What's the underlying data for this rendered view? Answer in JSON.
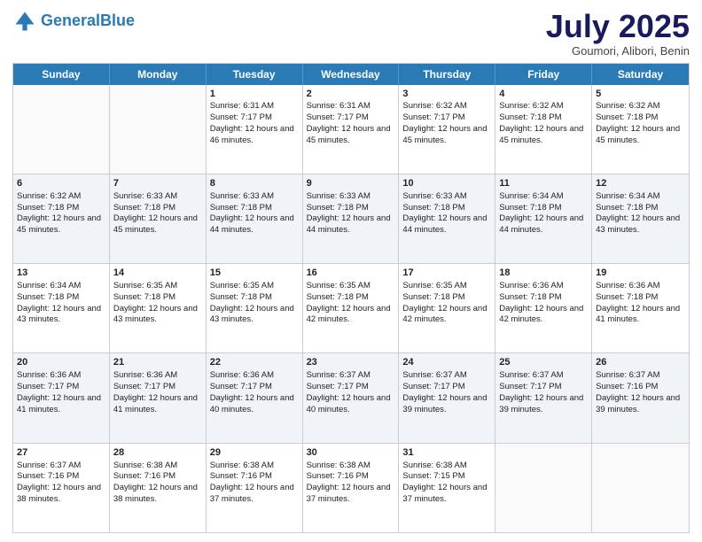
{
  "header": {
    "logo_line1": "General",
    "logo_line2": "Blue",
    "month": "July 2025",
    "location": "Goumori, Alibori, Benin"
  },
  "weekdays": [
    "Sunday",
    "Monday",
    "Tuesday",
    "Wednesday",
    "Thursday",
    "Friday",
    "Saturday"
  ],
  "weeks": [
    [
      {
        "day": "",
        "info": ""
      },
      {
        "day": "",
        "info": ""
      },
      {
        "day": "1",
        "info": "Sunrise: 6:31 AM\nSunset: 7:17 PM\nDaylight: 12 hours and 46 minutes."
      },
      {
        "day": "2",
        "info": "Sunrise: 6:31 AM\nSunset: 7:17 PM\nDaylight: 12 hours and 45 minutes."
      },
      {
        "day": "3",
        "info": "Sunrise: 6:32 AM\nSunset: 7:17 PM\nDaylight: 12 hours and 45 minutes."
      },
      {
        "day": "4",
        "info": "Sunrise: 6:32 AM\nSunset: 7:18 PM\nDaylight: 12 hours and 45 minutes."
      },
      {
        "day": "5",
        "info": "Sunrise: 6:32 AM\nSunset: 7:18 PM\nDaylight: 12 hours and 45 minutes."
      }
    ],
    [
      {
        "day": "6",
        "info": "Sunrise: 6:32 AM\nSunset: 7:18 PM\nDaylight: 12 hours and 45 minutes."
      },
      {
        "day": "7",
        "info": "Sunrise: 6:33 AM\nSunset: 7:18 PM\nDaylight: 12 hours and 45 minutes."
      },
      {
        "day": "8",
        "info": "Sunrise: 6:33 AM\nSunset: 7:18 PM\nDaylight: 12 hours and 44 minutes."
      },
      {
        "day": "9",
        "info": "Sunrise: 6:33 AM\nSunset: 7:18 PM\nDaylight: 12 hours and 44 minutes."
      },
      {
        "day": "10",
        "info": "Sunrise: 6:33 AM\nSunset: 7:18 PM\nDaylight: 12 hours and 44 minutes."
      },
      {
        "day": "11",
        "info": "Sunrise: 6:34 AM\nSunset: 7:18 PM\nDaylight: 12 hours and 44 minutes."
      },
      {
        "day": "12",
        "info": "Sunrise: 6:34 AM\nSunset: 7:18 PM\nDaylight: 12 hours and 43 minutes."
      }
    ],
    [
      {
        "day": "13",
        "info": "Sunrise: 6:34 AM\nSunset: 7:18 PM\nDaylight: 12 hours and 43 minutes."
      },
      {
        "day": "14",
        "info": "Sunrise: 6:35 AM\nSunset: 7:18 PM\nDaylight: 12 hours and 43 minutes."
      },
      {
        "day": "15",
        "info": "Sunrise: 6:35 AM\nSunset: 7:18 PM\nDaylight: 12 hours and 43 minutes."
      },
      {
        "day": "16",
        "info": "Sunrise: 6:35 AM\nSunset: 7:18 PM\nDaylight: 12 hours and 42 minutes."
      },
      {
        "day": "17",
        "info": "Sunrise: 6:35 AM\nSunset: 7:18 PM\nDaylight: 12 hours and 42 minutes."
      },
      {
        "day": "18",
        "info": "Sunrise: 6:36 AM\nSunset: 7:18 PM\nDaylight: 12 hours and 42 minutes."
      },
      {
        "day": "19",
        "info": "Sunrise: 6:36 AM\nSunset: 7:18 PM\nDaylight: 12 hours and 41 minutes."
      }
    ],
    [
      {
        "day": "20",
        "info": "Sunrise: 6:36 AM\nSunset: 7:17 PM\nDaylight: 12 hours and 41 minutes."
      },
      {
        "day": "21",
        "info": "Sunrise: 6:36 AM\nSunset: 7:17 PM\nDaylight: 12 hours and 41 minutes."
      },
      {
        "day": "22",
        "info": "Sunrise: 6:36 AM\nSunset: 7:17 PM\nDaylight: 12 hours and 40 minutes."
      },
      {
        "day": "23",
        "info": "Sunrise: 6:37 AM\nSunset: 7:17 PM\nDaylight: 12 hours and 40 minutes."
      },
      {
        "day": "24",
        "info": "Sunrise: 6:37 AM\nSunset: 7:17 PM\nDaylight: 12 hours and 39 minutes."
      },
      {
        "day": "25",
        "info": "Sunrise: 6:37 AM\nSunset: 7:17 PM\nDaylight: 12 hours and 39 minutes."
      },
      {
        "day": "26",
        "info": "Sunrise: 6:37 AM\nSunset: 7:16 PM\nDaylight: 12 hours and 39 minutes."
      }
    ],
    [
      {
        "day": "27",
        "info": "Sunrise: 6:37 AM\nSunset: 7:16 PM\nDaylight: 12 hours and 38 minutes."
      },
      {
        "day": "28",
        "info": "Sunrise: 6:38 AM\nSunset: 7:16 PM\nDaylight: 12 hours and 38 minutes."
      },
      {
        "day": "29",
        "info": "Sunrise: 6:38 AM\nSunset: 7:16 PM\nDaylight: 12 hours and 37 minutes."
      },
      {
        "day": "30",
        "info": "Sunrise: 6:38 AM\nSunset: 7:16 PM\nDaylight: 12 hours and 37 minutes."
      },
      {
        "day": "31",
        "info": "Sunrise: 6:38 AM\nSunset: 7:15 PM\nDaylight: 12 hours and 37 minutes."
      },
      {
        "day": "",
        "info": ""
      },
      {
        "day": "",
        "info": ""
      }
    ]
  ]
}
